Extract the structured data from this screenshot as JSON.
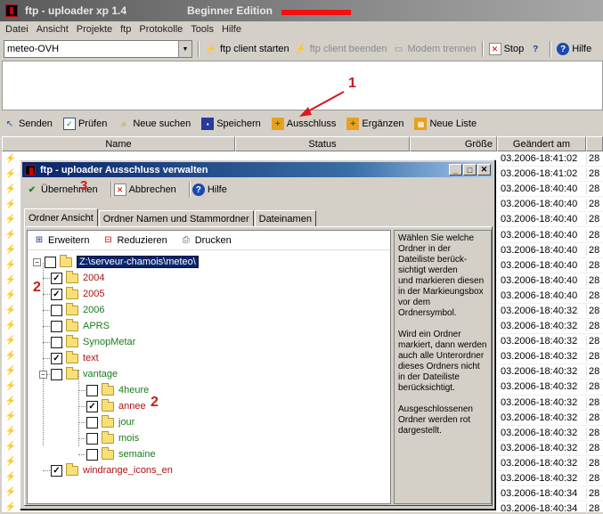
{
  "app": {
    "title": "ftp - uploader  xp 1.4",
    "edition": "Beginner Edition"
  },
  "menu": [
    "Datei",
    "Ansicht",
    "Projekte",
    "ftp",
    "Protokolle",
    "Tools",
    "Hilfe"
  ],
  "toolbar": {
    "project": "meteo-OVH",
    "start": "ftp client starten",
    "stop_client": "ftp client beenden",
    "modem": "Modem trennen",
    "stop": "Stop",
    "help": "Hilfe"
  },
  "actions": {
    "send": "Senden",
    "check": "Prüfen",
    "search": "Neue suchen",
    "save": "Speichern",
    "exclude": "Ausschluss",
    "add": "Ergänzen",
    "newlist": "Neue Liste"
  },
  "columns": {
    "name": "Name",
    "status": "Status",
    "size": "Größe",
    "changed": "Geändert am"
  },
  "rows": [
    {
      "date": "03.2006-18:41:02",
      "n": "28"
    },
    {
      "date": "03.2006-18:41:02",
      "n": "28"
    },
    {
      "date": "03.2006-18:40:40",
      "n": "28"
    },
    {
      "date": "03.2006-18:40:40",
      "n": "28"
    },
    {
      "date": "03.2006-18:40:40",
      "n": "28"
    },
    {
      "date": "03.2006-18:40:40",
      "n": "28"
    },
    {
      "date": "03.2006-18:40:40",
      "n": "28"
    },
    {
      "date": "03.2006-18:40:40",
      "n": "28"
    },
    {
      "date": "03.2006-18:40:40",
      "n": "28"
    },
    {
      "date": "03.2006-18:40:40",
      "n": "28"
    },
    {
      "date": "03.2006-18:40:32",
      "n": "28"
    },
    {
      "date": "03.2006-18:40:32",
      "n": "28"
    },
    {
      "date": "03.2006-18:40:32",
      "n": "28"
    },
    {
      "date": "03.2006-18:40:32",
      "n": "28"
    },
    {
      "date": "03.2006-18:40:32",
      "n": "28"
    },
    {
      "date": "03.2006-18:40:32",
      "n": "28"
    },
    {
      "date": "03.2006-18:40:32",
      "n": "28"
    },
    {
      "date": "03.2006-18:40:32",
      "n": "28"
    },
    {
      "date": "03.2006-18:40:32",
      "n": "28"
    },
    {
      "date": "03.2006-18:40:32",
      "n": "28"
    },
    {
      "date": "03.2006-18:40:32",
      "n": "28"
    },
    {
      "date": "03.2006-18:40:32",
      "n": "28"
    },
    {
      "date": "03.2006-18:40:34",
      "n": "28"
    },
    {
      "date": "03.2006-18:40:34",
      "n": "28"
    }
  ],
  "dialog": {
    "title": "ftp - uploader  Ausschluss verwalten",
    "accept": "Übernehmen",
    "cancel": "Abbrechen",
    "help": "Hilfe",
    "tabs": [
      "Ordner Ansicht",
      "Ordner Namen und Stammordner",
      "Dateinamen"
    ],
    "expand": "Erweitern",
    "reduce": "Reduzieren",
    "print": "Drucken",
    "root": "Z:\\serveur-chamois\\meteo\\",
    "help_text": "Wählen Sie welche Ordner in der Dateiliste berück-sichtigt werden\nund markieren diesen in der Markieungsbox vor dem Ordnersymbol.\n\nWird ein Ordner markiert, dann werden auch alle Unterordner dieses Ordners nicht in der Dateiliste berücksichtigt.\n\nAusgeschlossenen Ordner werden rot dargestellt."
  },
  "folders": [
    {
      "label": "2004",
      "checked": true
    },
    {
      "label": "2005",
      "checked": true
    },
    {
      "label": "2006",
      "checked": false
    },
    {
      "label": "APRS",
      "checked": false
    },
    {
      "label": "SynopMetar",
      "checked": false
    },
    {
      "label": "text",
      "checked": true
    },
    {
      "label": "vantage",
      "checked": false
    },
    {
      "label": "4heure",
      "checked": false
    },
    {
      "label": "annee",
      "checked": true
    },
    {
      "label": "jour",
      "checked": false
    },
    {
      "label": "mois",
      "checked": false
    },
    {
      "label": "semaine",
      "checked": false
    },
    {
      "label": "windrange_icons_en",
      "checked": true
    }
  ],
  "annotations": {
    "one": "1",
    "two": "2",
    "three": "3"
  },
  "colors": {
    "excluded": "#b01010",
    "included": "#1a7a1a",
    "annotation": "#c81a1a"
  }
}
